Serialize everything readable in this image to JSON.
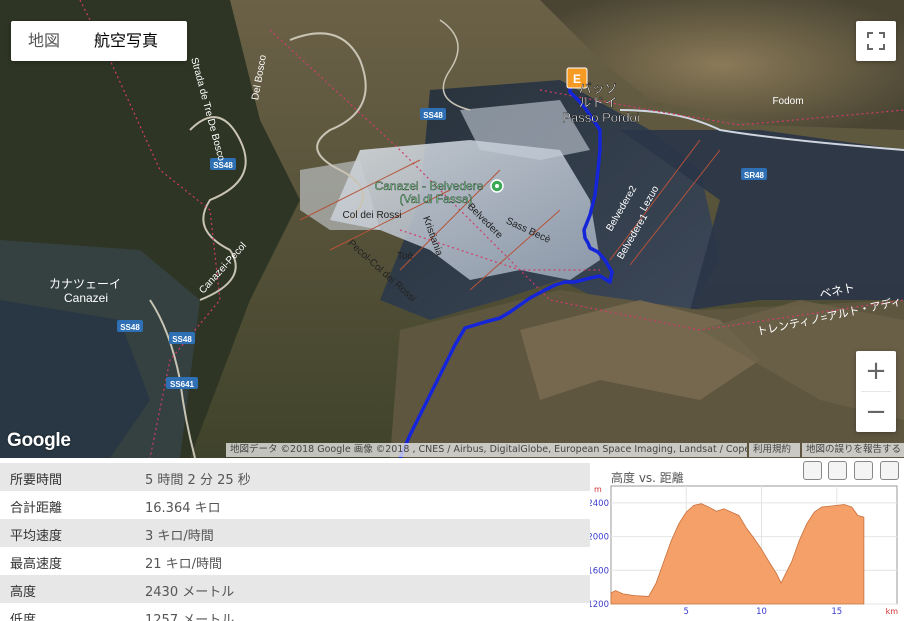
{
  "map_type": {
    "map_label": "地図",
    "satellite_label": "航空写真"
  },
  "fullscreen_icon": "fullscreen-icon",
  "zoom": {
    "in_label": "+",
    "out_label": "−"
  },
  "google_logo": "Google",
  "attribution": {
    "text": "地図データ ©2018 Google 画像 ©2018 , CNES / Airbus, DigitalGlobe, European Space Imaging, Landsat / Copernicus",
    "terms": "利用規約",
    "report": "地図の誤りを報告する"
  },
  "map_labels": {
    "passo_pordoi_jp": "パッソ",
    "passo_pordoi_jp2": "ルドイ",
    "passo_pordoi": "Passo Pordoi",
    "fodom": "Fodom",
    "canazei_belvedere": "Canazei - Belvedere",
    "val_di_fassa": "(Val di Fassa)",
    "canazei_jp": "カナツェーイ",
    "canazei": "Canazei",
    "col_dei_rossi": "Col dei Rossi",
    "kristiania": "Kristiania",
    "belvedere": "Belvedere",
    "sass_bece": "Sass Becè",
    "toe": "Toè",
    "pecol_col_dei_rossi": "Pecol-Col dei Rossi",
    "canazei_pecol": "Canazei-Pecol",
    "del_bosco": "Del Bosco",
    "tre_de_bosco": "Strada de Tre De Bosco",
    "belvedere2": "Belvedere2",
    "belvedere1": "Belvedere1",
    "lezuo": "Lezuo",
    "nenet": "ベネト",
    "trentino": "トレンティノ=アルト・アディ",
    "ss48": "SS48",
    "sr48": "SR48",
    "ss641": "SS641",
    "end_marker": "E"
  },
  "stats": [
    {
      "key": "所要時間",
      "value": "5 時間 2 分 25 秒"
    },
    {
      "key": "合計距離",
      "value": "16.364 キロ"
    },
    {
      "key": "平均速度",
      "value": "3 キロ/時間"
    },
    {
      "key": "最高速度",
      "value": "21 キロ/時間"
    },
    {
      "key": "高度",
      "value": "2430 メートル"
    },
    {
      "key": "低度",
      "value": "1257 メートル"
    }
  ],
  "elevation": {
    "title": "高度 vs. 距離",
    "y_unit": "m",
    "x_unit": "km"
  },
  "chart_data": {
    "type": "area",
    "title": "高度 vs. 距離",
    "xlabel": "km",
    "ylabel": "m",
    "xlim": [
      0,
      19
    ],
    "ylim": [
      1200,
      2600
    ],
    "x_ticks": [
      5,
      10,
      15
    ],
    "y_ticks": [
      1200,
      1600,
      2000,
      2400
    ],
    "fill_color": "#f4a068",
    "series": [
      {
        "x": [
          0,
          0.3,
          0.8,
          1.5,
          2.5,
          3.0,
          3.5,
          4.0,
          4.5,
          5.0,
          5.5,
          6.0,
          6.5,
          7.0,
          7.5,
          8.0,
          8.5,
          9.0,
          9.5,
          10.0,
          10.5,
          11.0,
          11.3,
          11.6,
          12.0,
          12.5,
          13.0,
          13.5,
          14.0,
          14.5,
          15.0,
          15.5,
          16.0,
          16.4,
          16.8
        ],
        "y": [
          1330,
          1360,
          1320,
          1300,
          1290,
          1450,
          1700,
          1950,
          2150,
          2290,
          2370,
          2390,
          2350,
          2300,
          2330,
          2290,
          2250,
          2100,
          1980,
          1850,
          1700,
          1560,
          1450,
          1560,
          1700,
          1950,
          2150,
          2290,
          2350,
          2360,
          2370,
          2380,
          2350,
          2250,
          2230
        ]
      }
    ]
  }
}
